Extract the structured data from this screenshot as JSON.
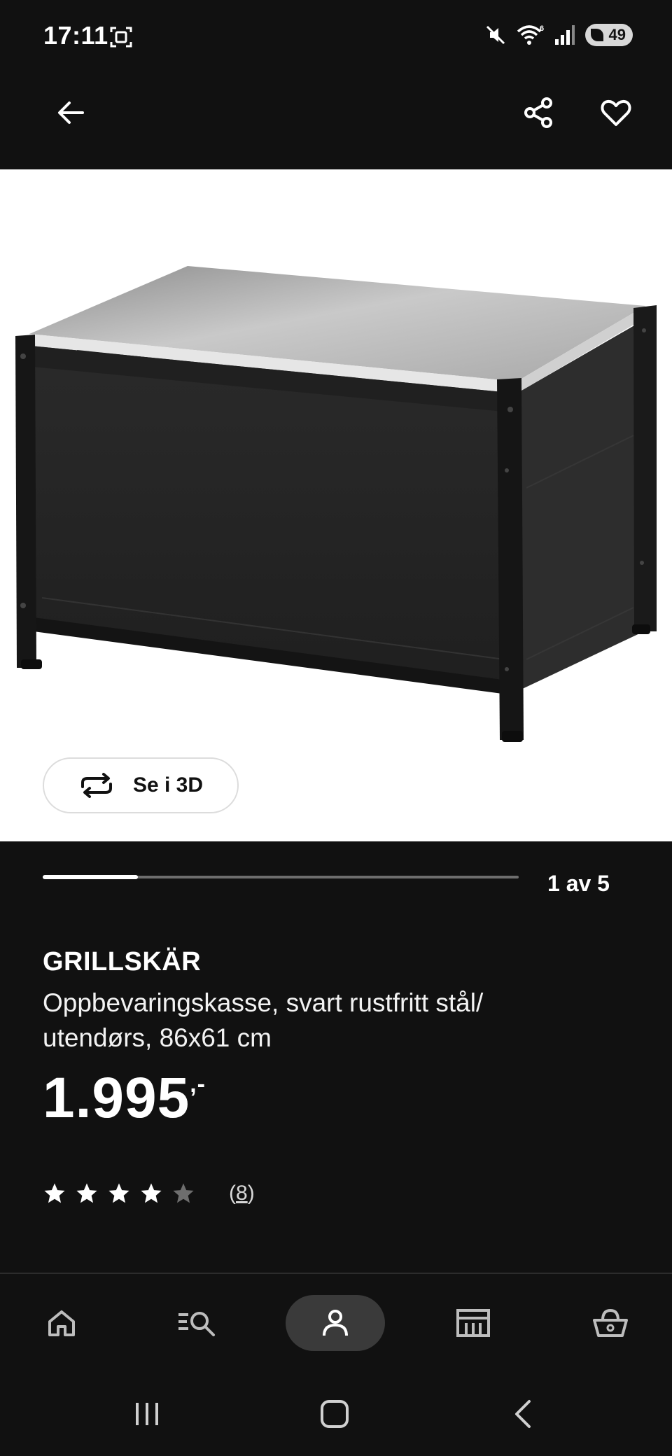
{
  "status_bar": {
    "time": "17:11",
    "battery_level": "49"
  },
  "gallery": {
    "see_3d_label": "Se i 3D",
    "current_index": 1,
    "total": 5,
    "counter_label": "1 av 5",
    "progress_fraction": 0.2
  },
  "product": {
    "name": "GRILLSKÄR",
    "description": "Oppbevaringskasse, svart rustfritt stål/ utendørs, 86x61 cm",
    "price_main": "1.995",
    "price_suffix": ",-",
    "rating_value": 4,
    "rating_max": 5,
    "review_count_open": "(",
    "review_count": "8",
    "review_count_close": ")"
  },
  "icons": {
    "back": "arrow-left-icon",
    "share": "share-icon",
    "favorite": "heart-icon",
    "rotate_3d": "rotate-icon",
    "star_filled": "star-icon",
    "star_empty": "star-outline-icon"
  },
  "bottom_nav": {
    "items": [
      "home",
      "search-products",
      "account",
      "store",
      "basket"
    ],
    "active": "account"
  },
  "colors": {
    "background": "#111111",
    "hero_background": "#ffffff",
    "text": "#ffffff",
    "star_filled": "#ffffff",
    "star_empty": "#6e6e6e",
    "active_pill": "#3a3a3a"
  }
}
